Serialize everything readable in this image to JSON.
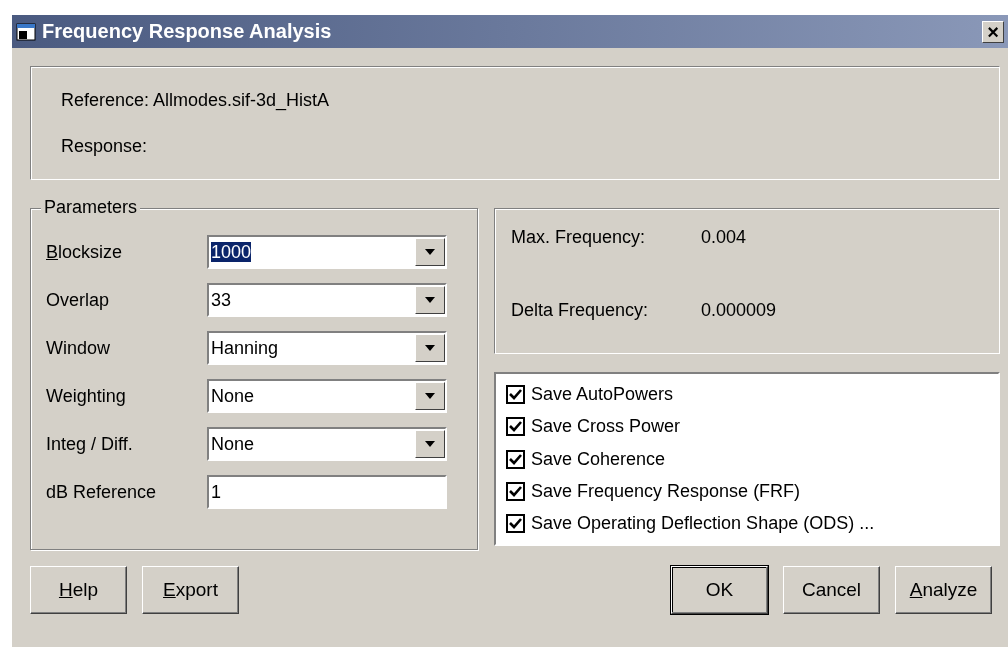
{
  "window": {
    "title": "Frequency Response Analysis",
    "close": "×"
  },
  "source": [
    {
      "text": "Reference: Allmodes.sif-3d_HistA"
    },
    {
      "text": "Response:"
    }
  ],
  "parameters": {
    "title": "Parameters",
    "fields": [
      {
        "label": "Blocksize",
        "underline_first": true,
        "kind": "combo",
        "value": "1000",
        "selected": true
      },
      {
        "label": "Overlap",
        "underline_first": false,
        "kind": "combo",
        "value": "33",
        "selected": false
      },
      {
        "label": "Window",
        "underline_first": false,
        "kind": "combo",
        "value": "Hanning",
        "selected": false
      },
      {
        "label": "Weighting",
        "underline_first": false,
        "kind": "combo",
        "value": "None",
        "selected": false
      },
      {
        "label": "Integ / Diff.",
        "underline_first": false,
        "kind": "combo",
        "value": "None",
        "selected": false
      },
      {
        "label": "dB Reference",
        "underline_first": false,
        "kind": "text",
        "value": "1",
        "selected": false
      }
    ]
  },
  "info": [
    {
      "label": "Max. Frequency:",
      "value": "0.004"
    },
    {
      "label": "Delta Frequency:",
      "value": "0.000009"
    }
  ],
  "options": [
    {
      "label": "Save AutoPowers",
      "checked": true
    },
    {
      "label": "Save Cross Power",
      "checked": true
    },
    {
      "label": "Save Coherence",
      "checked": true
    },
    {
      "label": "Save Frequency Response (FRF)",
      "checked": true
    },
    {
      "label": "Save Operating Deflection Shape (ODS) ...",
      "checked": true
    }
  ],
  "left_buttons": [
    {
      "label": "Help",
      "underline_first": true,
      "default": false
    },
    {
      "label": "Export",
      "underline_first": true,
      "default": false
    }
  ],
  "right_buttons": [
    {
      "label": "OK",
      "underline_first": false,
      "default": true
    },
    {
      "label": "Cancel",
      "underline_first": false,
      "default": false
    },
    {
      "label": "Analyze",
      "underline_first": true,
      "default": false
    }
  ]
}
